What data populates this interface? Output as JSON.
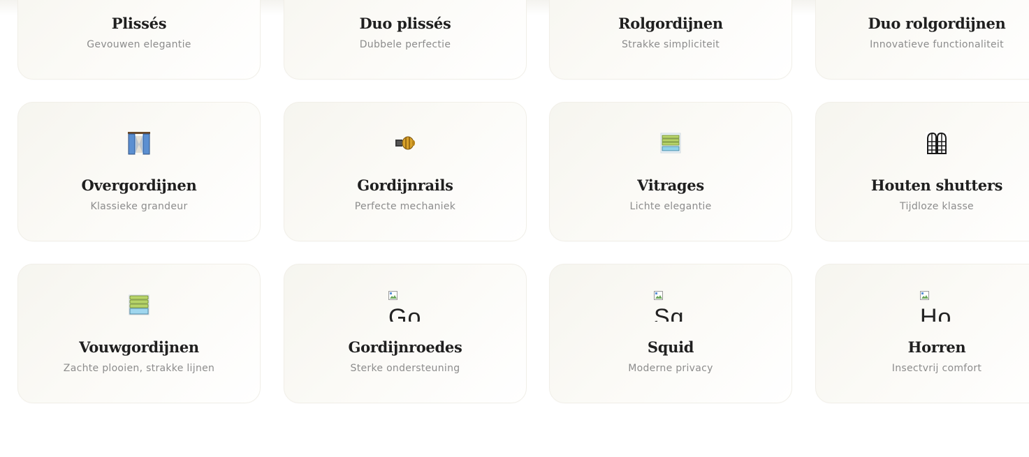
{
  "products": [
    {
      "title": "Plissés",
      "subtitle": "Gevouwen elegantie",
      "icon": "none"
    },
    {
      "title": "Duo plissés",
      "subtitle": "Dubbele perfectie",
      "icon": "none"
    },
    {
      "title": "Rolgordijnen",
      "subtitle": "Strakke simpliciteit",
      "icon": "none"
    },
    {
      "title": "Duo rolgordijnen",
      "subtitle": "Innovatieve functionaliteit",
      "icon": "none"
    },
    {
      "title": "Overgordijnen",
      "subtitle": "Klassieke grandeur",
      "icon": "curtains-icon"
    },
    {
      "title": "Gordijnrails",
      "subtitle": "Perfecte mechaniek",
      "icon": "curtain-rail-icon"
    },
    {
      "title": "Vitrages",
      "subtitle": "Lichte elegantie",
      "icon": "window-blind-icon"
    },
    {
      "title": "Houten shutters",
      "subtitle": "Tijdloze klasse",
      "icon": "shutters-icon"
    },
    {
      "title": "Vouwgordijnen",
      "subtitle": "Zachte plooien, strakke lijnen",
      "icon": "roman-blind-icon"
    },
    {
      "title": "Gordijnroedes",
      "subtitle": "Sterke ondersteuning",
      "icon": "broken-image-icon",
      "alt_text": "Go"
    },
    {
      "title": "Squid",
      "subtitle": "Moderne privacy",
      "icon": "broken-image-icon",
      "alt_text": "Sq"
    },
    {
      "title": "Horren",
      "subtitle": "Insectvrij comfort",
      "icon": "broken-image-icon",
      "alt_text": "Ho"
    }
  ],
  "colors": {
    "title": "#1f1f1f",
    "subtitle": "#8c8c8c",
    "card_bg": "#f8f7f2",
    "page_bg": "#ffffff"
  }
}
